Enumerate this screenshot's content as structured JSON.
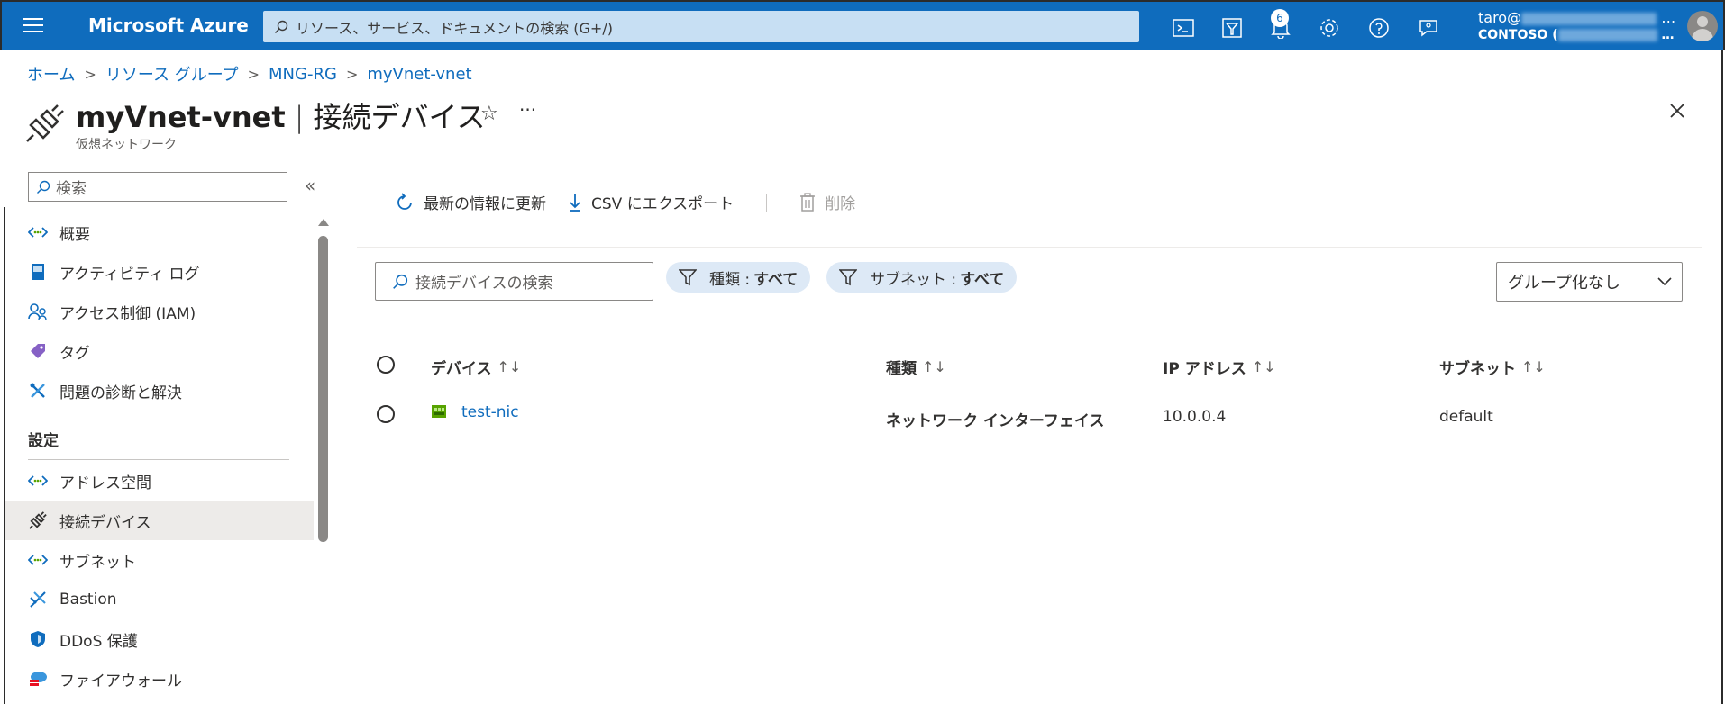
{
  "topbar": {
    "brand": "Microsoft Azure",
    "search_placeholder": "リソース、サービス、ドキュメントの検索 (G+/)",
    "notifications_count": "6",
    "account_name": "taro@",
    "account_tenant": "CONTOSO (",
    "ellipsis": "…"
  },
  "breadcrumb": [
    "ホーム",
    "リソース グループ",
    "MNG-RG",
    "myVnet-vnet"
  ],
  "header": {
    "resource": "myVnet-vnet",
    "separator": "|",
    "page": "接続デバイス",
    "subtitle": "仮想ネットワーク",
    "more": "···"
  },
  "sidebar": {
    "search_placeholder": "検索",
    "collapse": "«",
    "items": [
      {
        "label": "概要",
        "icon": "overview-icon"
      },
      {
        "label": "アクティビティ ログ",
        "icon": "activity-log-icon"
      },
      {
        "label": "アクセス制御 (IAM)",
        "icon": "iam-icon"
      },
      {
        "label": "タグ",
        "icon": "tag-icon"
      },
      {
        "label": "問題の診断と解決",
        "icon": "diagnose-icon"
      }
    ],
    "section_label": "設定",
    "settings_items": [
      {
        "label": "アドレス空間",
        "icon": "address-space-icon"
      },
      {
        "label": "接続デバイス",
        "icon": "connected-devices-icon",
        "active": true
      },
      {
        "label": "サブネット",
        "icon": "subnet-icon"
      },
      {
        "label": "Bastion",
        "icon": "bastion-icon"
      },
      {
        "label": "DDoS 保護",
        "icon": "ddos-icon"
      },
      {
        "label": "ファイアウォール",
        "icon": "firewall-icon"
      }
    ]
  },
  "commands": {
    "refresh": "最新の情報に更新",
    "export_csv": "CSV にエクスポート",
    "delete": "削除"
  },
  "filters": {
    "search_placeholder": "接続デバイスの検索",
    "type_label": "種類 :",
    "type_value": "すべて",
    "subnet_label": "サブネット :",
    "subnet_value": "すべて",
    "grouping": "グループ化なし"
  },
  "table": {
    "columns": [
      "デバイス",
      "種類",
      "IP アドレス",
      "サブネット"
    ],
    "sort_glyph": "↑↓",
    "rows": [
      {
        "device": "test-nic",
        "type": "ネットワーク インターフェイス",
        "ip": "10.0.0.4",
        "subnet": "default"
      }
    ]
  },
  "colors": {
    "brand_blue": "#0f6cbd",
    "search_bg": "#c7dff3",
    "pill_bg": "#dde9f6",
    "active_nav_bg": "#edebe9"
  }
}
